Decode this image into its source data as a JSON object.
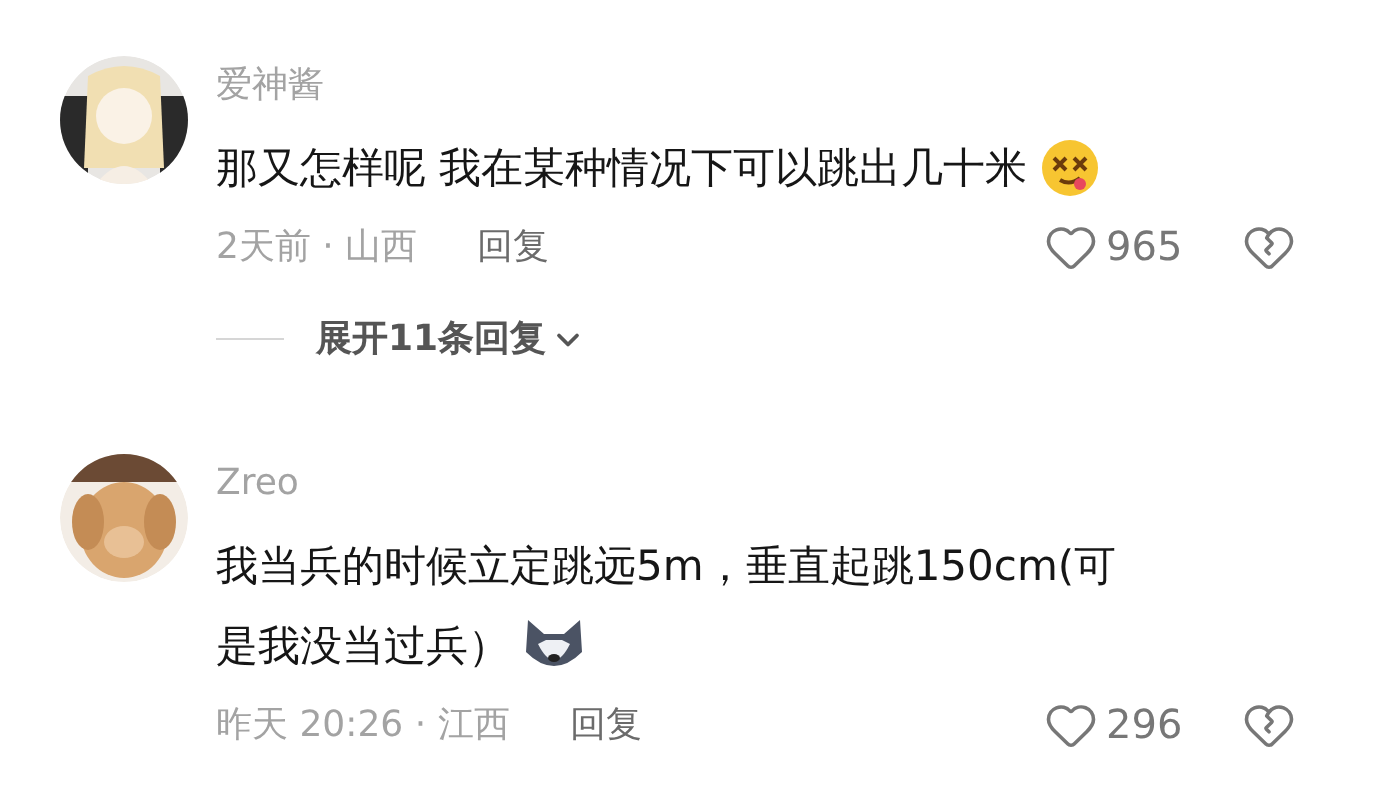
{
  "comments": [
    {
      "name": "爱神酱",
      "lines": [
        "那又怎样呢 我在某种情况下可以跳出几十米"
      ],
      "meta": "2天前 · 山西",
      "reply": "回复",
      "likes": "965",
      "expand": "展开11条回复"
    },
    {
      "name": "Zreo",
      "lines": [
        "我当兵的时候立定跳远5m，垂直起跳150cm(可",
        "是我没当过兵）"
      ],
      "meta": "昨天 20:26 · 江西",
      "reply": "回复",
      "likes": "296"
    }
  ]
}
